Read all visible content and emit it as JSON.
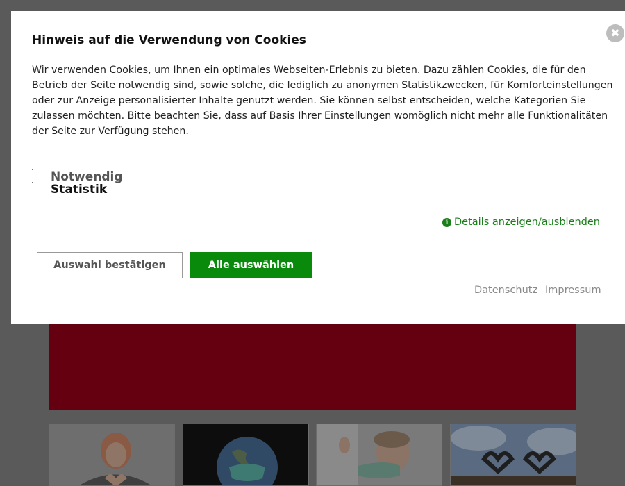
{
  "modal": {
    "title": "Hinweis auf die Verwendung von Cookies",
    "close_icon": "close-icon",
    "description": "Wir verwenden Cookies, um Ihnen ein optimales Webseiten-Erlebnis zu bieten. Dazu zählen Cookies, die für den Betrieb der Seite notwendig sind, sowie solche, die lediglich zu anonymen Statistikzwecken, für Komforteinstellungen oder zur Anzeige personalisierter Inhalte genutzt werden. Sie können selbst entscheiden, welche Kategorien Sie zulassen möchten. Bitte beachten Sie, dass auf Basis Ihrer Einstellungen womöglich nicht mehr alle Funktionalitäten der Seite zur Verfügung stehen.",
    "categories": [
      {
        "label": "Notwendig"
      },
      {
        "label": "Statistik"
      }
    ],
    "details_icon": "info-icon",
    "details_label": "Details anzeigen/ausblenden",
    "confirm_button": "Auswahl bestätigen",
    "select_all_button": "Alle auswählen",
    "links": {
      "privacy": "Datenschutz",
      "imprint": "Impressum"
    }
  },
  "colors": {
    "overlay": "#5a5a5a",
    "accent_green": "#0a8a0a",
    "hero_red": "#650010"
  }
}
